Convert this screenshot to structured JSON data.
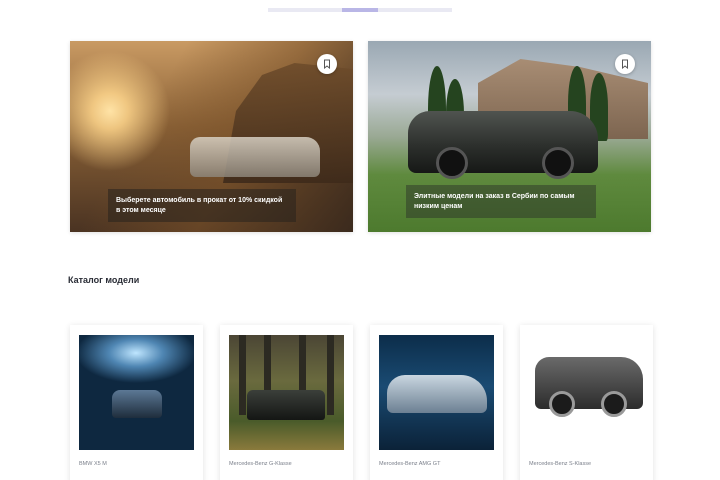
{
  "pager": {
    "segments": 5,
    "active_index": 2,
    "accent_color": "#b9b6e6",
    "inactive_color": "#e9e9f3"
  },
  "hero_cards": [
    {
      "caption": "Выберете автомобиль в прокат от 10% скидкой в этом месяце",
      "icon": "bookmark-icon"
    },
    {
      "caption": "Элитные модели на заказ в Сербии по самым низким ценам",
      "icon": "bookmark-icon"
    }
  ],
  "section": {
    "title": "Каталог модели"
  },
  "models": [
    {
      "label": "BMW X5 M"
    },
    {
      "label": "Mercedes-Benz G-Klasse"
    },
    {
      "label": "Mercedes-Benz AMG GT"
    },
    {
      "label": "Mercedes-Benz S-Klasse"
    }
  ]
}
